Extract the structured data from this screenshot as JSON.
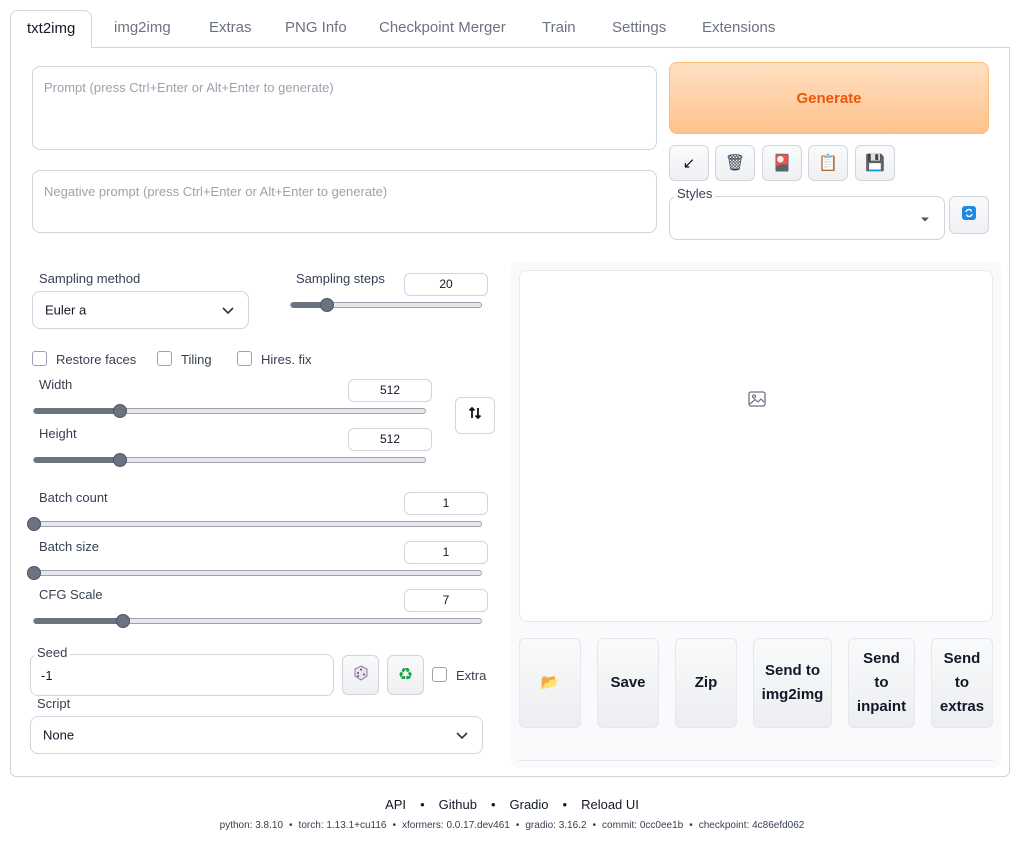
{
  "tabs": [
    "txt2img",
    "img2img",
    "Extras",
    "PNG Info",
    "Checkpoint Merger",
    "Train",
    "Settings",
    "Extensions"
  ],
  "prompt": {
    "placeholder": "Prompt (press Ctrl+Enter or Alt+Enter to generate)"
  },
  "negative_prompt": {
    "placeholder": "Negative prompt (press Ctrl+Enter or Alt+Enter to generate)"
  },
  "generate_label": "Generate",
  "tool_buttons": [
    {
      "icon": "arrow-down-left-icon",
      "glyph": "↙"
    },
    {
      "icon": "trash-icon",
      "glyph": "🗑"
    },
    {
      "icon": "card-icon",
      "glyph": "🎴"
    },
    {
      "icon": "clipboard-icon",
      "glyph": "📋"
    },
    {
      "icon": "save-icon",
      "glyph": "💾"
    }
  ],
  "styles": {
    "label": "Styles",
    "value": ""
  },
  "sampling_method": {
    "label": "Sampling method",
    "value": "Euler a"
  },
  "sampling_steps": {
    "label": "Sampling steps",
    "value": "20",
    "fraction": 0.19
  },
  "checkboxes": {
    "restore_faces": "Restore faces",
    "tiling": "Tiling",
    "hires_fix": "Hires. fix"
  },
  "width": {
    "label": "Width",
    "value": "512",
    "fraction": 0.22
  },
  "height": {
    "label": "Height",
    "value": "512",
    "fraction": 0.22
  },
  "batch_count": {
    "label": "Batch count",
    "value": "1",
    "fraction": 0.0
  },
  "batch_size": {
    "label": "Batch size",
    "value": "1",
    "fraction": 0.0
  },
  "cfg_scale": {
    "label": "CFG Scale",
    "value": "7",
    "fraction": 0.2
  },
  "seed": {
    "label": "Seed",
    "value": "-1",
    "extra_label": "Extra"
  },
  "script": {
    "label": "Script",
    "value": "None"
  },
  "actions": {
    "folder_glyph": "📂",
    "save": "Save",
    "zip": "Zip",
    "send_img2img": "Send to img2img",
    "send_inpaint": "Send to inpaint",
    "send_extras": "Send to extras"
  },
  "footer": {
    "links": [
      "API",
      "Github",
      "Gradio",
      "Reload UI"
    ],
    "versions": [
      "python: 3.8.10",
      "torch: 1.13.1+cu116",
      "xformers: 0.0.17.dev461",
      "gradio: 3.16.2",
      "commit: 0cc0ee1b",
      "checkpoint: 4c86efd062"
    ]
  }
}
